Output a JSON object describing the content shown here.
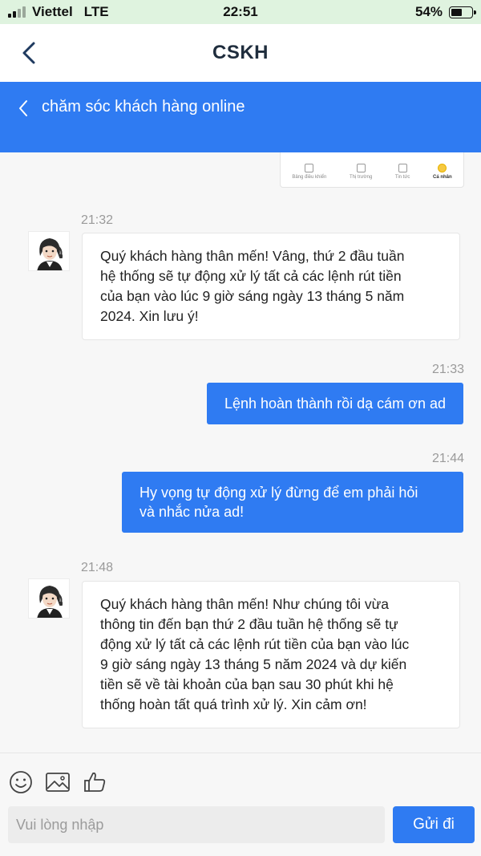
{
  "status_bar": {
    "carrier": "Viettel",
    "network": "LTE",
    "time": "22:51",
    "battery_percent": "54%",
    "battery_level": 0.54,
    "signal_bars_active": 2,
    "signal_bars_total": 4
  },
  "header": {
    "title": "CSKH",
    "back_icon": "chevron-left-icon"
  },
  "sub_header": {
    "title": "chăm sóc khách hàng online",
    "background_color": "#2f7bf2"
  },
  "image_fragment": {
    "tabs": [
      "Bảng điều khiển",
      "Thị trường",
      "Tin tức",
      "Cá nhân"
    ],
    "active_tab": "Cá nhân"
  },
  "messages": [
    {
      "direction": "in",
      "time": "21:32",
      "lines": [
        "Quý khách hàng thân mến! Vâng, thứ 2 đầu tuần",
        "hệ thống sẽ tự động xử lý tất cả các lệnh rút tiền",
        "của bạn vào lúc 9 giờ sáng ngày 13 tháng 5 năm",
        "2024. Xin lưu ý!"
      ]
    },
    {
      "direction": "out",
      "time": "21:33",
      "lines": [
        "Lệnh hoàn thành rồi dạ cám ơn ad"
      ]
    },
    {
      "direction": "out",
      "time": "21:44",
      "lines": [
        "Hy vọng tự động xử lý đừng để em phải hỏi",
        "và nhắc nửa ad!"
      ]
    },
    {
      "direction": "in",
      "time": "21:48",
      "lines": [
        "Quý khách hàng thân mến! Như chúng tôi vừa",
        "thông tin đến bạn thứ 2 đầu tuần hệ thống sẽ tự",
        "động xử lý tất cả các lệnh rút tiền của bạn vào lúc",
        "9 giờ sáng ngày 13 tháng 5 năm 2024 và dự kiến",
        "tiền sẽ về tài khoản của bạn sau 30 phút khi hệ",
        "thống hoàn tất quá trình xử lý. Xin cảm ơn!"
      ]
    }
  ],
  "composer": {
    "tools": [
      "smiley-icon",
      "image-icon",
      "thumbs-up-icon"
    ],
    "input_placeholder": "Vui lòng nhập",
    "input_value": "",
    "send_label": "Gửi đi"
  },
  "colors": {
    "accent": "#2f7bf2",
    "status_bar_bg": "#dff3df"
  }
}
